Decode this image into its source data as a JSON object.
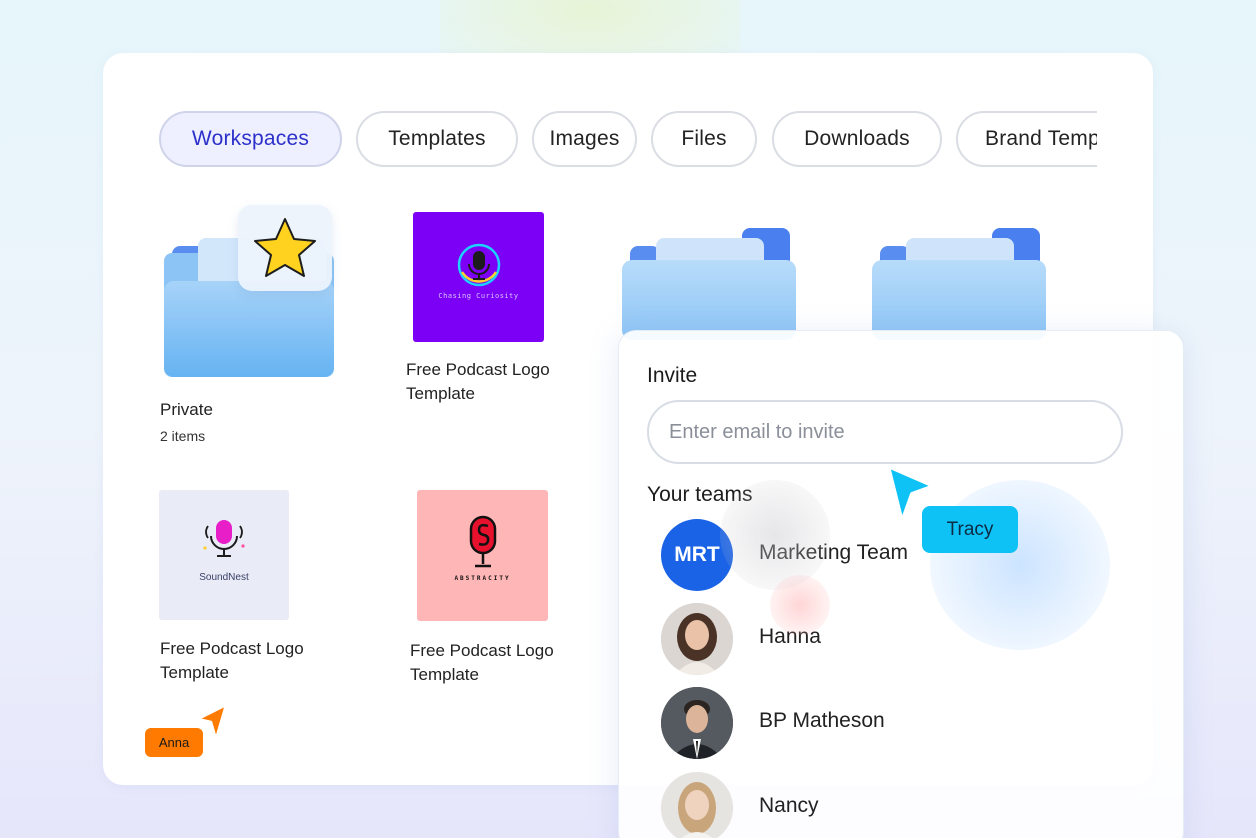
{
  "tabs": [
    {
      "label": "Workspaces",
      "active": true
    },
    {
      "label": "Templates",
      "active": false
    },
    {
      "label": "Images",
      "active": false
    },
    {
      "label": "Files",
      "active": false
    },
    {
      "label": "Downloads",
      "active": false
    },
    {
      "label": "Brand Templates",
      "active": false
    }
  ],
  "items": {
    "private": {
      "title": "Private",
      "subtitle": "2 items"
    },
    "podcast1": {
      "title_line1": "Free Podcast Logo",
      "title_line2": "Template",
      "thumb_text": "Chasing Curiosity"
    },
    "podcast2": {
      "title_line1": "Free Podcast Logo",
      "title_line2": "Template",
      "thumb_text": "SoundNest"
    },
    "podcast3": {
      "title_line1": "Free Podcast Logo",
      "title_line2": "Template",
      "thumb_text": "ABSTRACITY"
    }
  },
  "invite": {
    "title": "Invite",
    "email_placeholder": "Enter email to invite",
    "teams_title": "Your teams",
    "members": [
      {
        "name": "Marketing Team",
        "initials": "MRT"
      },
      {
        "name": "Hanna"
      },
      {
        "name": "BP Matheson"
      },
      {
        "name": "Nancy"
      }
    ]
  },
  "cursors": {
    "anna": {
      "label": "Anna",
      "color": "#ff7a00"
    },
    "tracy": {
      "label": "Tracy",
      "color": "#0ec2f5"
    }
  },
  "colors": {
    "active_tab_text": "#2d31c9",
    "folder_blue": "#66b3f2",
    "mrt_avatar": "#1a63e6",
    "thumb_purple": "#7c00f5",
    "thumb_pink": "#ffb6b6",
    "thumb_lavender": "#e9ebf6"
  },
  "icons": {
    "favorite": "star-icon",
    "folders": "folder-icon",
    "microphone": "microphone-icon",
    "cursor": "cursor-arrow-icon"
  }
}
